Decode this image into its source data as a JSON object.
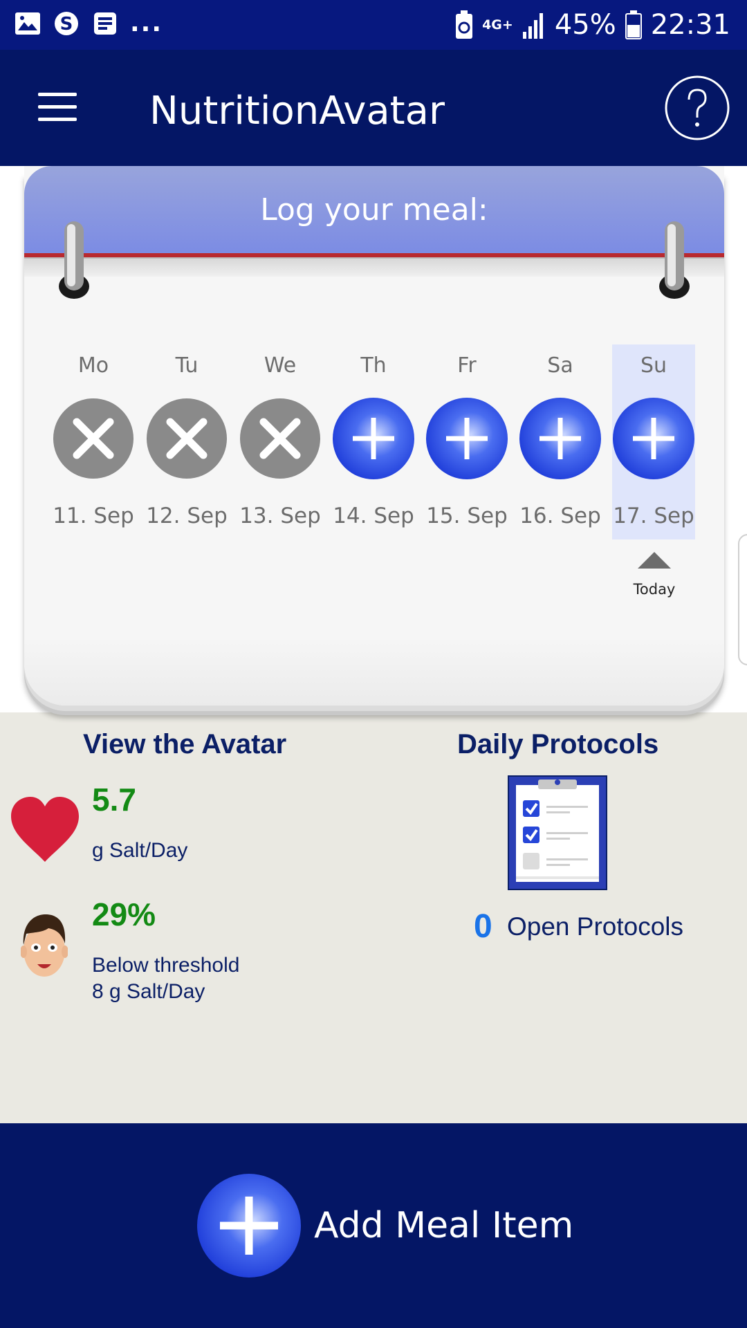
{
  "status_bar": {
    "icons": [
      "gallery-icon",
      "skype-icon",
      "notes-icon"
    ],
    "more": "...",
    "network": "4G+",
    "battery_percent": "45%",
    "time": "22:31"
  },
  "app_bar": {
    "title": "NutritionAvatar",
    "menu_icon": "hamburger-menu-icon",
    "help_icon": "help-icon"
  },
  "calendar": {
    "title": "Log your meal:",
    "days": [
      {
        "name": "Mo",
        "date": "11. Sep",
        "state": "missed"
      },
      {
        "name": "Tu",
        "date": "12. Sep",
        "state": "missed"
      },
      {
        "name": "We",
        "date": "13. Sep",
        "state": "missed"
      },
      {
        "name": "Th",
        "date": "14. Sep",
        "state": "add"
      },
      {
        "name": "Fr",
        "date": "15. Sep",
        "state": "add"
      },
      {
        "name": "Sa",
        "date": "16. Sep",
        "state": "add"
      },
      {
        "name": "Su",
        "date": "17. Sep",
        "state": "add"
      }
    ],
    "today_label": "Today"
  },
  "avatar": {
    "title": "View the Avatar",
    "salt_value": "5.7",
    "salt_unit": "g Salt/Day",
    "percent_value": "29%",
    "threshold_line1": "Below threshold",
    "threshold_line2": "8 g Salt/Day"
  },
  "protocols": {
    "title": "Daily Protocols",
    "open_count": "0",
    "open_label": "Open Protocols"
  },
  "bottom_bar": {
    "add_label": "Add Meal Item"
  },
  "colors": {
    "primary": "#041665",
    "status": "#07187f",
    "accent_blue": "#2f56e8",
    "missed_gray": "#8a8a8a",
    "value_green": "#138a14",
    "heart_red": "#d61f3b"
  }
}
